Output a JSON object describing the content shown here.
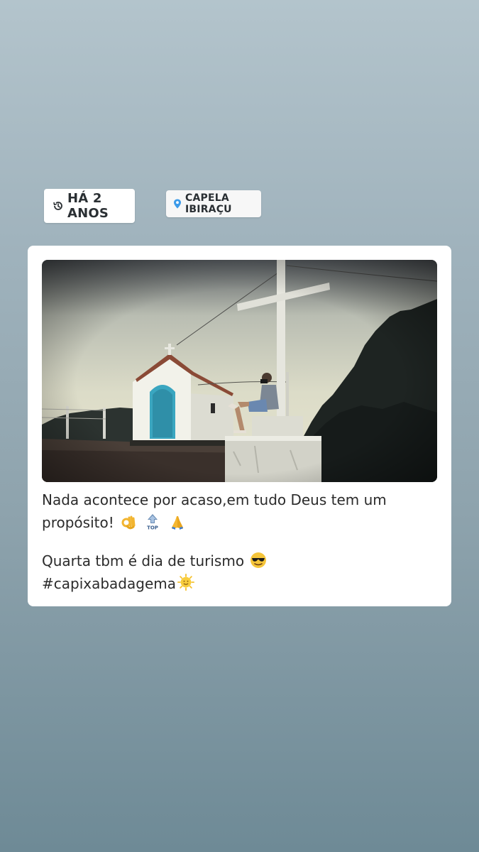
{
  "stickers": {
    "time": {
      "icon": "history-icon",
      "label": "HÁ 2 ANOS"
    },
    "location": {
      "icon": "location-pin-icon",
      "label": "CAPELA IBIRAÇU"
    }
  },
  "post": {
    "photo": {
      "description_icon": "photo-chapel-cross"
    },
    "caption": {
      "line1": "Nada acontece por acaso,em tudo Deus tem um",
      "line2": "propósito!",
      "line2_emojis": [
        "ok-hand-icon",
        "top-arrow-icon",
        "praying-hands-icon"
      ],
      "line3": "Quarta tbm é dia de turismo",
      "line3_emoji": "sunglasses-face-icon",
      "line4": "#capixabadagema",
      "line4_emoji": "sun-face-icon"
    }
  },
  "colors": {
    "background_top": "#b3c4cc",
    "background_bottom": "#6e8a96",
    "card": "#ffffff",
    "location_pin": "#3d9be9",
    "door": "#3aa6c0"
  }
}
